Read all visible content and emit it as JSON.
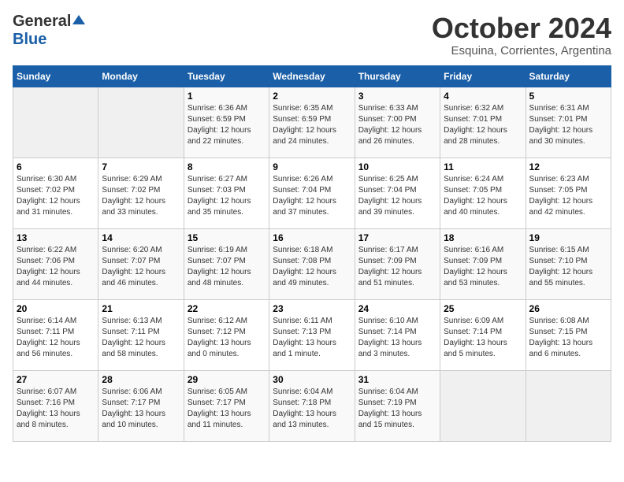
{
  "header": {
    "logo_general": "General",
    "logo_blue": "Blue",
    "month": "October 2024",
    "location": "Esquina, Corrientes, Argentina"
  },
  "weekdays": [
    "Sunday",
    "Monday",
    "Tuesday",
    "Wednesday",
    "Thursday",
    "Friday",
    "Saturday"
  ],
  "weeks": [
    [
      {
        "day": "",
        "empty": true
      },
      {
        "day": "",
        "empty": true
      },
      {
        "day": "1",
        "sunrise": "Sunrise: 6:36 AM",
        "sunset": "Sunset: 6:59 PM",
        "daylight": "Daylight: 12 hours and 22 minutes."
      },
      {
        "day": "2",
        "sunrise": "Sunrise: 6:35 AM",
        "sunset": "Sunset: 6:59 PM",
        "daylight": "Daylight: 12 hours and 24 minutes."
      },
      {
        "day": "3",
        "sunrise": "Sunrise: 6:33 AM",
        "sunset": "Sunset: 7:00 PM",
        "daylight": "Daylight: 12 hours and 26 minutes."
      },
      {
        "day": "4",
        "sunrise": "Sunrise: 6:32 AM",
        "sunset": "Sunset: 7:01 PM",
        "daylight": "Daylight: 12 hours and 28 minutes."
      },
      {
        "day": "5",
        "sunrise": "Sunrise: 6:31 AM",
        "sunset": "Sunset: 7:01 PM",
        "daylight": "Daylight: 12 hours and 30 minutes."
      }
    ],
    [
      {
        "day": "6",
        "sunrise": "Sunrise: 6:30 AM",
        "sunset": "Sunset: 7:02 PM",
        "daylight": "Daylight: 12 hours and 31 minutes."
      },
      {
        "day": "7",
        "sunrise": "Sunrise: 6:29 AM",
        "sunset": "Sunset: 7:02 PM",
        "daylight": "Daylight: 12 hours and 33 minutes."
      },
      {
        "day": "8",
        "sunrise": "Sunrise: 6:27 AM",
        "sunset": "Sunset: 7:03 PM",
        "daylight": "Daylight: 12 hours and 35 minutes."
      },
      {
        "day": "9",
        "sunrise": "Sunrise: 6:26 AM",
        "sunset": "Sunset: 7:04 PM",
        "daylight": "Daylight: 12 hours and 37 minutes."
      },
      {
        "day": "10",
        "sunrise": "Sunrise: 6:25 AM",
        "sunset": "Sunset: 7:04 PM",
        "daylight": "Daylight: 12 hours and 39 minutes."
      },
      {
        "day": "11",
        "sunrise": "Sunrise: 6:24 AM",
        "sunset": "Sunset: 7:05 PM",
        "daylight": "Daylight: 12 hours and 40 minutes."
      },
      {
        "day": "12",
        "sunrise": "Sunrise: 6:23 AM",
        "sunset": "Sunset: 7:05 PM",
        "daylight": "Daylight: 12 hours and 42 minutes."
      }
    ],
    [
      {
        "day": "13",
        "sunrise": "Sunrise: 6:22 AM",
        "sunset": "Sunset: 7:06 PM",
        "daylight": "Daylight: 12 hours and 44 minutes."
      },
      {
        "day": "14",
        "sunrise": "Sunrise: 6:20 AM",
        "sunset": "Sunset: 7:07 PM",
        "daylight": "Daylight: 12 hours and 46 minutes."
      },
      {
        "day": "15",
        "sunrise": "Sunrise: 6:19 AM",
        "sunset": "Sunset: 7:07 PM",
        "daylight": "Daylight: 12 hours and 48 minutes."
      },
      {
        "day": "16",
        "sunrise": "Sunrise: 6:18 AM",
        "sunset": "Sunset: 7:08 PM",
        "daylight": "Daylight: 12 hours and 49 minutes."
      },
      {
        "day": "17",
        "sunrise": "Sunrise: 6:17 AM",
        "sunset": "Sunset: 7:09 PM",
        "daylight": "Daylight: 12 hours and 51 minutes."
      },
      {
        "day": "18",
        "sunrise": "Sunrise: 6:16 AM",
        "sunset": "Sunset: 7:09 PM",
        "daylight": "Daylight: 12 hours and 53 minutes."
      },
      {
        "day": "19",
        "sunrise": "Sunrise: 6:15 AM",
        "sunset": "Sunset: 7:10 PM",
        "daylight": "Daylight: 12 hours and 55 minutes."
      }
    ],
    [
      {
        "day": "20",
        "sunrise": "Sunrise: 6:14 AM",
        "sunset": "Sunset: 7:11 PM",
        "daylight": "Daylight: 12 hours and 56 minutes."
      },
      {
        "day": "21",
        "sunrise": "Sunrise: 6:13 AM",
        "sunset": "Sunset: 7:11 PM",
        "daylight": "Daylight: 12 hours and 58 minutes."
      },
      {
        "day": "22",
        "sunrise": "Sunrise: 6:12 AM",
        "sunset": "Sunset: 7:12 PM",
        "daylight": "Daylight: 13 hours and 0 minutes."
      },
      {
        "day": "23",
        "sunrise": "Sunrise: 6:11 AM",
        "sunset": "Sunset: 7:13 PM",
        "daylight": "Daylight: 13 hours and 1 minute."
      },
      {
        "day": "24",
        "sunrise": "Sunrise: 6:10 AM",
        "sunset": "Sunset: 7:14 PM",
        "daylight": "Daylight: 13 hours and 3 minutes."
      },
      {
        "day": "25",
        "sunrise": "Sunrise: 6:09 AM",
        "sunset": "Sunset: 7:14 PM",
        "daylight": "Daylight: 13 hours and 5 minutes."
      },
      {
        "day": "26",
        "sunrise": "Sunrise: 6:08 AM",
        "sunset": "Sunset: 7:15 PM",
        "daylight": "Daylight: 13 hours and 6 minutes."
      }
    ],
    [
      {
        "day": "27",
        "sunrise": "Sunrise: 6:07 AM",
        "sunset": "Sunset: 7:16 PM",
        "daylight": "Daylight: 13 hours and 8 minutes."
      },
      {
        "day": "28",
        "sunrise": "Sunrise: 6:06 AM",
        "sunset": "Sunset: 7:17 PM",
        "daylight": "Daylight: 13 hours and 10 minutes."
      },
      {
        "day": "29",
        "sunrise": "Sunrise: 6:05 AM",
        "sunset": "Sunset: 7:17 PM",
        "daylight": "Daylight: 13 hours and 11 minutes."
      },
      {
        "day": "30",
        "sunrise": "Sunrise: 6:04 AM",
        "sunset": "Sunset: 7:18 PM",
        "daylight": "Daylight: 13 hours and 13 minutes."
      },
      {
        "day": "31",
        "sunrise": "Sunrise: 6:04 AM",
        "sunset": "Sunset: 7:19 PM",
        "daylight": "Daylight: 13 hours and 15 minutes."
      },
      {
        "day": "",
        "empty": true
      },
      {
        "day": "",
        "empty": true
      }
    ]
  ]
}
